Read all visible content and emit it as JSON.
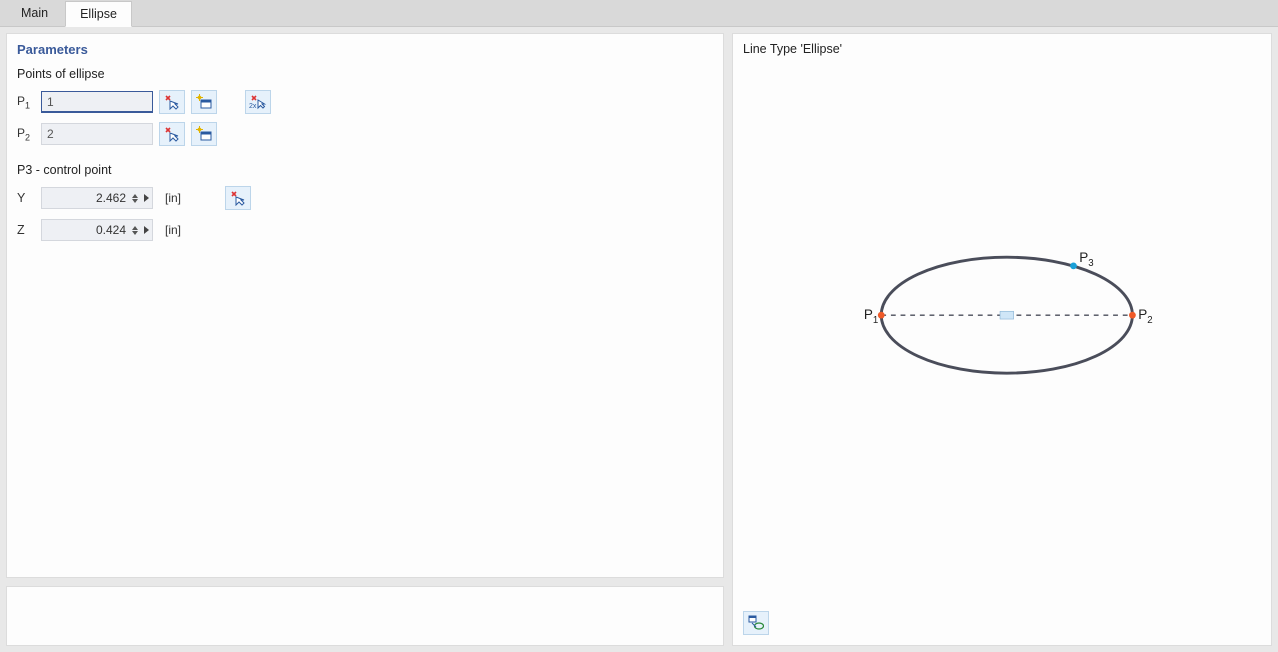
{
  "tabs": {
    "main": "Main",
    "ellipse": "Ellipse",
    "active": "ellipse"
  },
  "params": {
    "title": "Parameters",
    "points_heading": "Points of ellipse",
    "p1_label_main": "P",
    "p1_label_sub": "1",
    "p1_value": "1",
    "p2_label_main": "P",
    "p2_label_sub": "2",
    "p2_value": "2",
    "control_heading": "P3 - control point",
    "y_label": "Y",
    "y_value": "2.462",
    "y_unit": "[in]",
    "z_label": "Z",
    "z_value": "0.424",
    "z_unit": "[in]"
  },
  "preview": {
    "title": "Line Type 'Ellipse'",
    "p1": "P",
    "p1s": "1",
    "p2": "P",
    "p2s": "2",
    "p3": "P",
    "p3s": "3"
  }
}
